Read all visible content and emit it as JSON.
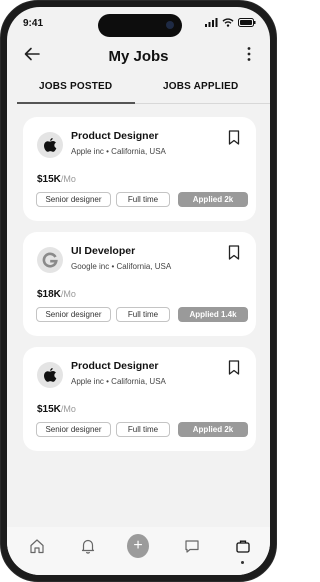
{
  "status_bar": {
    "time": "9:41"
  },
  "header": {
    "title": "My Jobs",
    "back_icon": "arrow-left-icon",
    "menu_icon": "more-vertical-icon"
  },
  "tabs": [
    {
      "label": "JOBS POSTED",
      "active": true
    },
    {
      "label": "JOBS APPLIED",
      "active": false
    }
  ],
  "jobs": [
    {
      "role": "Product Designer",
      "company": "Apple inc",
      "location": "California, USA",
      "salary": "$15K",
      "period": "/Mo",
      "tags": [
        "Senior designer",
        "Full time"
      ],
      "applied": "Applied 2k",
      "logo": "apple-logo"
    },
    {
      "role": "UI Developer",
      "company": "Google inc",
      "location": "California, USA",
      "salary": "$18K",
      "period": "/Mo",
      "tags": [
        "Senior designer",
        "Full time"
      ],
      "applied": "Applied 1.4k",
      "logo": "google-logo"
    },
    {
      "role": "Product Designer",
      "company": "Apple inc",
      "location": "California, USA",
      "salary": "$15K",
      "period": "/Mo",
      "tags": [
        "Senior designer",
        "Full time"
      ],
      "applied": "Applied 2k",
      "logo": "apple-logo"
    }
  ],
  "bottom_nav": [
    {
      "icon": "home-icon"
    },
    {
      "icon": "bell-icon"
    },
    {
      "icon": "plus-icon",
      "label": "+"
    },
    {
      "icon": "chat-icon"
    },
    {
      "icon": "briefcase-icon",
      "active": true
    }
  ],
  "colors": {
    "background": "#f2f2f2",
    "card": "#ffffff",
    "applied_badge": "#9a9a9a",
    "add_button": "#9b9b9b",
    "text": "#111111"
  }
}
